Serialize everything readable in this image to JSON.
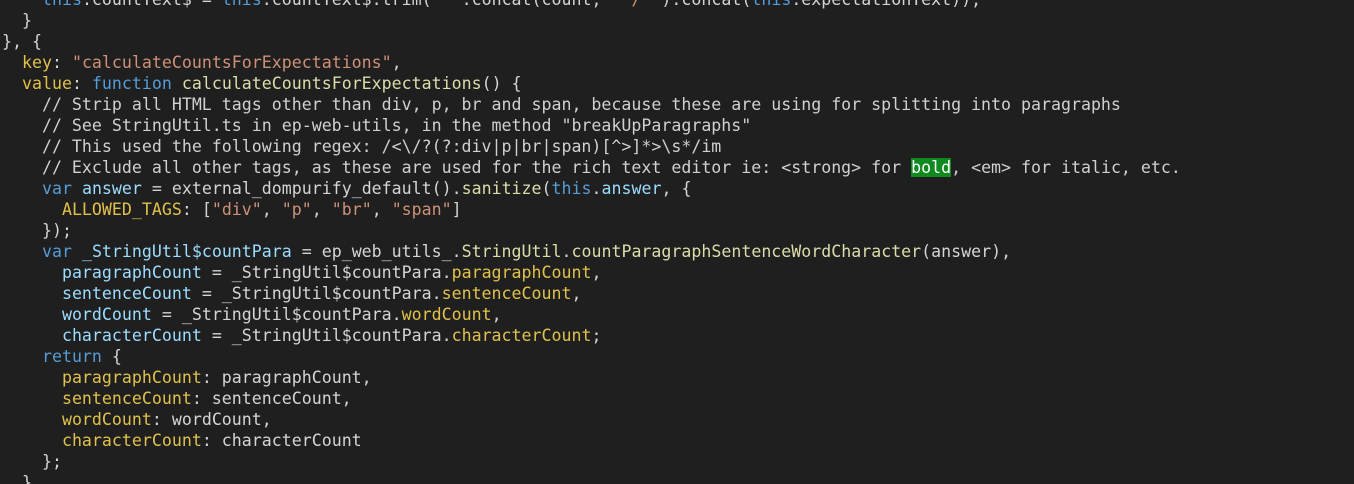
{
  "theme": {
    "background": "#1f1f1f",
    "plain": "#d4d4d4",
    "property": "#9cdcfe",
    "object_key": "#e0c14b",
    "string": "#ce9178",
    "keyword": "#569cd6",
    "function": "#dcdcaa",
    "comment": "#d0d0d0",
    "highlight_background": "#0f8a1f"
  },
  "lines": [
    [
      {
        "t": "    ",
        "c": "plain"
      },
      {
        "t": "this",
        "c": "this"
      },
      {
        "t": ".countText$ = ",
        "c": "plain"
      },
      {
        "t": "this",
        "c": "this"
      },
      {
        "t": ".countText$.trim(",
        "c": "plain"
      },
      {
        "t": "\" \"",
        "c": "str"
      },
      {
        "t": ".concat(count, ",
        "c": "plain"
      },
      {
        "t": "\" / \"",
        "c": "str"
      },
      {
        "t": ").concat(",
        "c": "plain"
      },
      {
        "t": "this",
        "c": "this"
      },
      {
        "t": ".expectationText));",
        "c": "plain"
      }
    ],
    [
      {
        "t": "  }",
        "c": "plain"
      }
    ],
    [
      {
        "t": "}, {",
        "c": "plain"
      }
    ],
    [
      {
        "t": "  ",
        "c": "plain"
      },
      {
        "t": "key",
        "c": "key"
      },
      {
        "t": ": ",
        "c": "plain"
      },
      {
        "t": "\"calculateCountsForExpectations\"",
        "c": "str"
      },
      {
        "t": ",",
        "c": "plain"
      }
    ],
    [
      {
        "t": "  ",
        "c": "plain"
      },
      {
        "t": "value",
        "c": "key"
      },
      {
        "t": ": ",
        "c": "plain"
      },
      {
        "t": "function",
        "c": "kw"
      },
      {
        "t": " ",
        "c": "plain"
      },
      {
        "t": "calculateCountsForExpectations",
        "c": "fn"
      },
      {
        "t": "() {",
        "c": "plain"
      }
    ],
    [
      {
        "t": "    // Strip all HTML tags other than div, p, br and span, because these are using for splitting into paragraphs",
        "c": "cmt"
      }
    ],
    [
      {
        "t": "    // See StringUtil.ts in ep-web-utils, in the method \"breakUpParagraphs\"",
        "c": "cmt"
      }
    ],
    [
      {
        "t": "    // This used the following regex: /<\\/?(?:div|p|br|span)[^>]*>\\s*/im",
        "c": "cmt"
      }
    ],
    [
      {
        "t": "    // Exclude all other tags, as these are used for the rich text editor ie: <strong> for ",
        "c": "cmt"
      },
      {
        "t": "bold",
        "c": "hl"
      },
      {
        "t": ", <em> for italic, etc.",
        "c": "cmt"
      }
    ],
    [
      {
        "t": "    ",
        "c": "plain"
      },
      {
        "t": "var",
        "c": "kw"
      },
      {
        "t": " ",
        "c": "plain"
      },
      {
        "t": "answer",
        "c": "prop"
      },
      {
        "t": " = external_dompurify_default().",
        "c": "plain"
      },
      {
        "t": "sanitize",
        "c": "fn"
      },
      {
        "t": "(",
        "c": "plain"
      },
      {
        "t": "this",
        "c": "this"
      },
      {
        "t": ".",
        "c": "plain"
      },
      {
        "t": "answer",
        "c": "prop"
      },
      {
        "t": ", {",
        "c": "plain"
      }
    ],
    [
      {
        "t": "      ",
        "c": "plain"
      },
      {
        "t": "ALLOWED_TAGS",
        "c": "key"
      },
      {
        "t": ": [",
        "c": "plain"
      },
      {
        "t": "\"div\"",
        "c": "str"
      },
      {
        "t": ", ",
        "c": "plain"
      },
      {
        "t": "\"p\"",
        "c": "str"
      },
      {
        "t": ", ",
        "c": "plain"
      },
      {
        "t": "\"br\"",
        "c": "str"
      },
      {
        "t": ", ",
        "c": "plain"
      },
      {
        "t": "\"span\"",
        "c": "str"
      },
      {
        "t": "]",
        "c": "plain"
      }
    ],
    [
      {
        "t": "    });",
        "c": "plain"
      }
    ],
    [
      {
        "t": "    ",
        "c": "plain"
      },
      {
        "t": "var",
        "c": "kw"
      },
      {
        "t": " ",
        "c": "plain"
      },
      {
        "t": "_StringUtil$countPara",
        "c": "prop"
      },
      {
        "t": " = ep_web_utils_.",
        "c": "plain"
      },
      {
        "t": "StringUtil",
        "c": "fn"
      },
      {
        "t": ".",
        "c": "plain"
      },
      {
        "t": "countParagraphSentenceWordCharacter",
        "c": "fn"
      },
      {
        "t": "(answer),",
        "c": "plain"
      }
    ],
    [
      {
        "t": "      ",
        "c": "plain"
      },
      {
        "t": "paragraphCount",
        "c": "prop"
      },
      {
        "t": " = _StringUtil$countPara.",
        "c": "plain"
      },
      {
        "t": "paragraphCount",
        "c": "key"
      },
      {
        "t": ",",
        "c": "plain"
      }
    ],
    [
      {
        "t": "      ",
        "c": "plain"
      },
      {
        "t": "sentenceCount",
        "c": "prop"
      },
      {
        "t": " = _StringUtil$countPara.",
        "c": "plain"
      },
      {
        "t": "sentenceCount",
        "c": "key"
      },
      {
        "t": ",",
        "c": "plain"
      }
    ],
    [
      {
        "t": "      ",
        "c": "plain"
      },
      {
        "t": "wordCount",
        "c": "prop"
      },
      {
        "t": " = _StringUtil$countPara.",
        "c": "plain"
      },
      {
        "t": "wordCount",
        "c": "key"
      },
      {
        "t": ",",
        "c": "plain"
      }
    ],
    [
      {
        "t": "      ",
        "c": "plain"
      },
      {
        "t": "characterCount",
        "c": "prop"
      },
      {
        "t": " = _StringUtil$countPara.",
        "c": "plain"
      },
      {
        "t": "characterCount",
        "c": "key"
      },
      {
        "t": ";",
        "c": "plain"
      }
    ],
    [
      {
        "t": "    ",
        "c": "plain"
      },
      {
        "t": "return",
        "c": "kw"
      },
      {
        "t": " {",
        "c": "plain"
      }
    ],
    [
      {
        "t": "      ",
        "c": "plain"
      },
      {
        "t": "paragraphCount",
        "c": "key"
      },
      {
        "t": ": paragraphCount,",
        "c": "plain"
      }
    ],
    [
      {
        "t": "      ",
        "c": "plain"
      },
      {
        "t": "sentenceCount",
        "c": "key"
      },
      {
        "t": ": sentenceCount,",
        "c": "plain"
      }
    ],
    [
      {
        "t": "      ",
        "c": "plain"
      },
      {
        "t": "wordCount",
        "c": "key"
      },
      {
        "t": ": wordCount,",
        "c": "plain"
      }
    ],
    [
      {
        "t": "      ",
        "c": "plain"
      },
      {
        "t": "characterCount",
        "c": "key"
      },
      {
        "t": ": characterCount",
        "c": "plain"
      }
    ],
    [
      {
        "t": "    };",
        "c": "plain"
      }
    ],
    [
      {
        "t": "  }",
        "c": "plain"
      }
    ]
  ]
}
